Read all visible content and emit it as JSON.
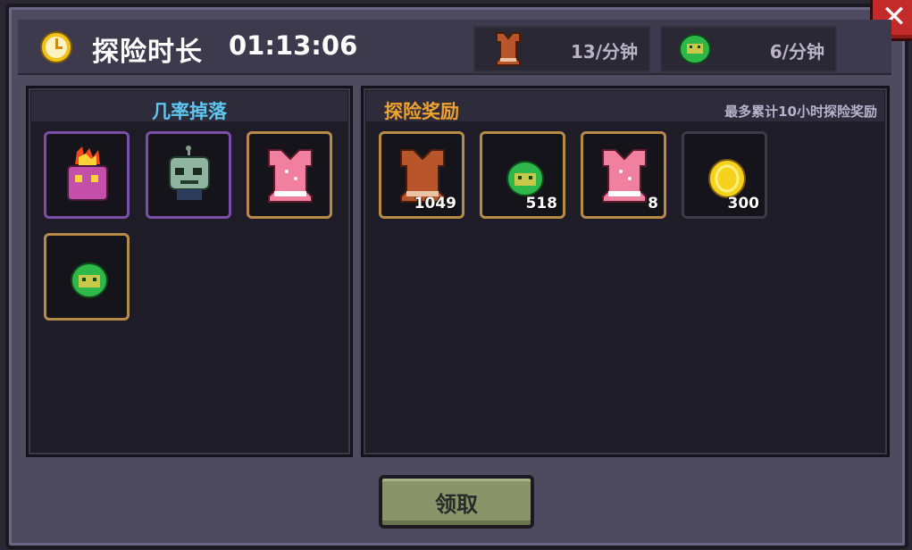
{
  "header": {
    "title": "探险时长",
    "timer": "01:13:06",
    "rates": [
      {
        "icon": "leather-armor-icon",
        "value": "13/分钟"
      },
      {
        "icon": "green-slime-coin-icon",
        "value": "6/分钟"
      }
    ]
  },
  "drops_panel": {
    "title": "几率掉落",
    "items": [
      {
        "icon": "fire-pot-pet-icon",
        "rarity": "purple"
      },
      {
        "icon": "zombie-head-pet-icon",
        "rarity": "purple"
      },
      {
        "icon": "pink-armor-icon",
        "rarity": "orange"
      },
      {
        "icon": "green-slime-coin-icon",
        "rarity": "orange"
      }
    ]
  },
  "rewards_panel": {
    "title": "探险奖励",
    "note": "最多累计10小时探险奖励",
    "items": [
      {
        "icon": "leather-armor-icon",
        "qty": "1049"
      },
      {
        "icon": "green-slime-coin-icon",
        "qty": "518"
      },
      {
        "icon": "pink-armor-icon",
        "qty": "8"
      },
      {
        "icon": "gold-coin-icon",
        "qty": "300"
      }
    ]
  },
  "claim_button": "领取",
  "close_button": "✕",
  "colors": {
    "accent_blue": "#5fc6ee",
    "accent_orange": "#f0a22e",
    "slot_orange": "#b78a47",
    "slot_purple": "#7c4ea8",
    "close_red": "#c32a2a"
  }
}
